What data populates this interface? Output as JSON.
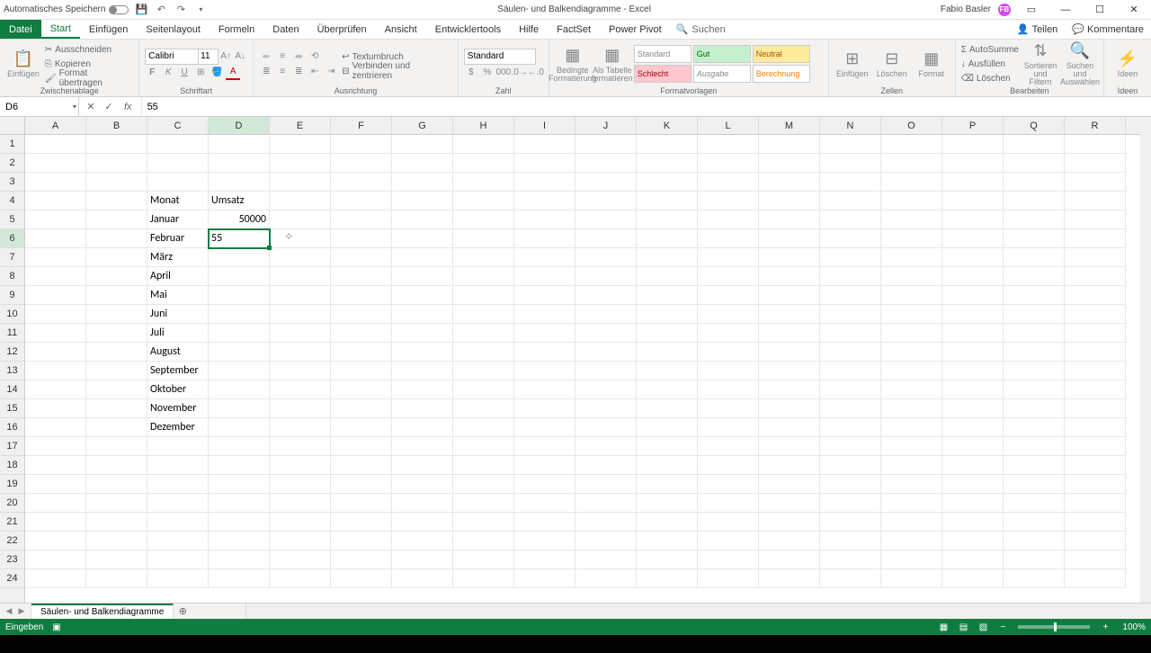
{
  "titlebar": {
    "autosave_label": "Automatisches Speichern",
    "doc_title": "Säulen- und Balkendiagramme  -  Excel",
    "user_name": "Fabio Basler",
    "user_initials": "FB"
  },
  "tabs": {
    "file": "Datei",
    "list": [
      "Start",
      "Einfügen",
      "Seitenlayout",
      "Formeln",
      "Daten",
      "Überprüfen",
      "Ansicht",
      "Entwicklertools",
      "Hilfe",
      "FactSet",
      "Power Pivot"
    ],
    "active": "Start",
    "search_placeholder": "Suchen",
    "share": "Teilen",
    "comments": "Kommentare"
  },
  "ribbon": {
    "clipboard": {
      "paste": "Einfügen",
      "cut": "Ausschneiden",
      "copy": "Kopieren",
      "format_painter": "Format übertragen",
      "label": "Zwischenablage"
    },
    "font": {
      "name": "Calibri",
      "size": "11",
      "label": "Schriftart"
    },
    "alignment": {
      "wrap": "Textumbruch",
      "merge": "Verbinden und zentrieren",
      "label": "Ausrichtung"
    },
    "number": {
      "format": "Standard",
      "label": "Zahl"
    },
    "styles": {
      "cond": "Bedingte Formatierung",
      "table": "Als Tabelle formatieren",
      "standard": "Standard",
      "gut": "Gut",
      "neutral": "Neutral",
      "schlecht": "Schlecht",
      "ausgabe": "Ausgabe",
      "berechnung": "Berechnung",
      "label": "Formatvorlagen"
    },
    "cells": {
      "insert": "Einfügen",
      "delete": "Löschen",
      "format": "Format",
      "label": "Zellen"
    },
    "editing": {
      "autosum": "AutoSumme",
      "fill": "Ausfüllen",
      "clear": "Löschen",
      "sort": "Sortieren und Filtern",
      "find": "Suchen und Auswählen",
      "label": "Bearbeiten"
    },
    "ideas": {
      "btn": "Ideen",
      "label": "Ideen"
    }
  },
  "formula_bar": {
    "cell_ref": "D6",
    "formula": "55"
  },
  "grid": {
    "columns": [
      "A",
      "B",
      "C",
      "D",
      "E",
      "F",
      "G",
      "H",
      "I",
      "J",
      "K",
      "L",
      "M",
      "N",
      "O",
      "P",
      "Q",
      "R"
    ],
    "active_col": "D",
    "active_row": 6,
    "active_cell_value": "55",
    "rows": [
      {
        "n": 1
      },
      {
        "n": 2
      },
      {
        "n": 3
      },
      {
        "n": 4,
        "C": "Monat",
        "D": "Umsatz"
      },
      {
        "n": 5,
        "C": "Januar",
        "D_num": "50000"
      },
      {
        "n": 6,
        "C": "Februar",
        "D": "55"
      },
      {
        "n": 7,
        "C": "März"
      },
      {
        "n": 8,
        "C": "April"
      },
      {
        "n": 9,
        "C": "Mai"
      },
      {
        "n": 10,
        "C": "Juni"
      },
      {
        "n": 11,
        "C": "Juli"
      },
      {
        "n": 12,
        "C": "August"
      },
      {
        "n": 13,
        "C": "September"
      },
      {
        "n": 14,
        "C": "Oktober"
      },
      {
        "n": 15,
        "C": "November"
      },
      {
        "n": 16,
        "C": "Dezember"
      },
      {
        "n": 17
      },
      {
        "n": 18
      },
      {
        "n": 19
      },
      {
        "n": 20
      },
      {
        "n": 21
      },
      {
        "n": 22
      },
      {
        "n": 23
      },
      {
        "n": 24
      }
    ]
  },
  "sheet": {
    "name": "Säulen- und Balkendiagramme"
  },
  "status": {
    "mode": "Eingeben",
    "zoom": "100%"
  }
}
